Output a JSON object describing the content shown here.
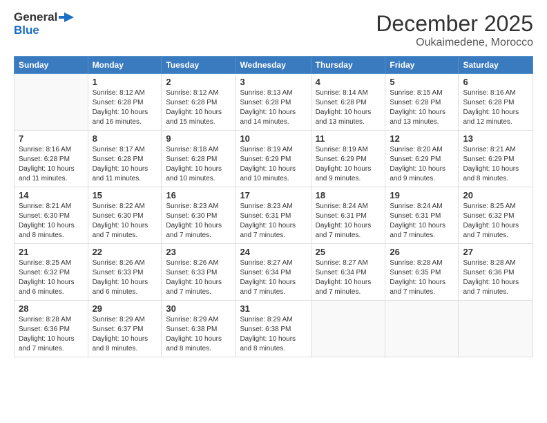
{
  "logo": {
    "line1": "General",
    "line2": "Blue"
  },
  "title": "December 2025",
  "location": "Oukaimedene, Morocco",
  "days_of_week": [
    "Sunday",
    "Monday",
    "Tuesday",
    "Wednesday",
    "Thursday",
    "Friday",
    "Saturday"
  ],
  "weeks": [
    [
      {
        "day": "",
        "info": ""
      },
      {
        "day": "1",
        "info": "Sunrise: 8:12 AM\nSunset: 6:28 PM\nDaylight: 10 hours\nand 16 minutes."
      },
      {
        "day": "2",
        "info": "Sunrise: 8:12 AM\nSunset: 6:28 PM\nDaylight: 10 hours\nand 15 minutes."
      },
      {
        "day": "3",
        "info": "Sunrise: 8:13 AM\nSunset: 6:28 PM\nDaylight: 10 hours\nand 14 minutes."
      },
      {
        "day": "4",
        "info": "Sunrise: 8:14 AM\nSunset: 6:28 PM\nDaylight: 10 hours\nand 13 minutes."
      },
      {
        "day": "5",
        "info": "Sunrise: 8:15 AM\nSunset: 6:28 PM\nDaylight: 10 hours\nand 13 minutes."
      },
      {
        "day": "6",
        "info": "Sunrise: 8:16 AM\nSunset: 6:28 PM\nDaylight: 10 hours\nand 12 minutes."
      }
    ],
    [
      {
        "day": "7",
        "info": "Sunrise: 8:16 AM\nSunset: 6:28 PM\nDaylight: 10 hours\nand 11 minutes."
      },
      {
        "day": "8",
        "info": "Sunrise: 8:17 AM\nSunset: 6:28 PM\nDaylight: 10 hours\nand 11 minutes."
      },
      {
        "day": "9",
        "info": "Sunrise: 8:18 AM\nSunset: 6:28 PM\nDaylight: 10 hours\nand 10 minutes."
      },
      {
        "day": "10",
        "info": "Sunrise: 8:19 AM\nSunset: 6:29 PM\nDaylight: 10 hours\nand 10 minutes."
      },
      {
        "day": "11",
        "info": "Sunrise: 8:19 AM\nSunset: 6:29 PM\nDaylight: 10 hours\nand 9 minutes."
      },
      {
        "day": "12",
        "info": "Sunrise: 8:20 AM\nSunset: 6:29 PM\nDaylight: 10 hours\nand 9 minutes."
      },
      {
        "day": "13",
        "info": "Sunrise: 8:21 AM\nSunset: 6:29 PM\nDaylight: 10 hours\nand 8 minutes."
      }
    ],
    [
      {
        "day": "14",
        "info": "Sunrise: 8:21 AM\nSunset: 6:30 PM\nDaylight: 10 hours\nand 8 minutes."
      },
      {
        "day": "15",
        "info": "Sunrise: 8:22 AM\nSunset: 6:30 PM\nDaylight: 10 hours\nand 7 minutes."
      },
      {
        "day": "16",
        "info": "Sunrise: 8:23 AM\nSunset: 6:30 PM\nDaylight: 10 hours\nand 7 minutes."
      },
      {
        "day": "17",
        "info": "Sunrise: 8:23 AM\nSunset: 6:31 PM\nDaylight: 10 hours\nand 7 minutes."
      },
      {
        "day": "18",
        "info": "Sunrise: 8:24 AM\nSunset: 6:31 PM\nDaylight: 10 hours\nand 7 minutes."
      },
      {
        "day": "19",
        "info": "Sunrise: 8:24 AM\nSunset: 6:31 PM\nDaylight: 10 hours\nand 7 minutes."
      },
      {
        "day": "20",
        "info": "Sunrise: 8:25 AM\nSunset: 6:32 PM\nDaylight: 10 hours\nand 7 minutes."
      }
    ],
    [
      {
        "day": "21",
        "info": "Sunrise: 8:25 AM\nSunset: 6:32 PM\nDaylight: 10 hours\nand 6 minutes."
      },
      {
        "day": "22",
        "info": "Sunrise: 8:26 AM\nSunset: 6:33 PM\nDaylight: 10 hours\nand 6 minutes."
      },
      {
        "day": "23",
        "info": "Sunrise: 8:26 AM\nSunset: 6:33 PM\nDaylight: 10 hours\nand 7 minutes."
      },
      {
        "day": "24",
        "info": "Sunrise: 8:27 AM\nSunset: 6:34 PM\nDaylight: 10 hours\nand 7 minutes."
      },
      {
        "day": "25",
        "info": "Sunrise: 8:27 AM\nSunset: 6:34 PM\nDaylight: 10 hours\nand 7 minutes."
      },
      {
        "day": "26",
        "info": "Sunrise: 8:28 AM\nSunset: 6:35 PM\nDaylight: 10 hours\nand 7 minutes."
      },
      {
        "day": "27",
        "info": "Sunrise: 8:28 AM\nSunset: 6:36 PM\nDaylight: 10 hours\nand 7 minutes."
      }
    ],
    [
      {
        "day": "28",
        "info": "Sunrise: 8:28 AM\nSunset: 6:36 PM\nDaylight: 10 hours\nand 7 minutes."
      },
      {
        "day": "29",
        "info": "Sunrise: 8:29 AM\nSunset: 6:37 PM\nDaylight: 10 hours\nand 8 minutes."
      },
      {
        "day": "30",
        "info": "Sunrise: 8:29 AM\nSunset: 6:38 PM\nDaylight: 10 hours\nand 8 minutes."
      },
      {
        "day": "31",
        "info": "Sunrise: 8:29 AM\nSunset: 6:38 PM\nDaylight: 10 hours\nand 8 minutes."
      },
      {
        "day": "",
        "info": ""
      },
      {
        "day": "",
        "info": ""
      },
      {
        "day": "",
        "info": ""
      }
    ]
  ]
}
